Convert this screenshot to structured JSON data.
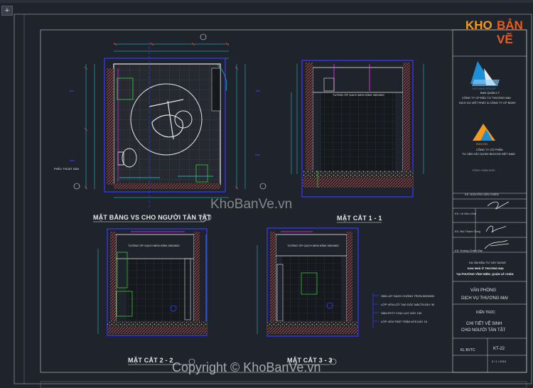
{
  "toolbar": {
    "new_tab_label": "+"
  },
  "titles": {
    "plan": "MẶT BẰNG VS CHO NGƯỜI TÀN TẬT",
    "sec11": "MẶT CẮT 1 - 1",
    "sec22": "MẶT CẮT 2 - 2",
    "sec33": "MẶT CẮT 3 - 3"
  },
  "section_notes": {
    "wall_tile_11": "TƯỜNG ỐP GẠCH MEN KÍNH 300X600",
    "wall_tile_22": "TƯỜNG ỐP GẠCH MEN KÍNH 300X600",
    "wall_tile_33": "TƯỜNG ỐP GẠCH MEN KÍNH 300X600",
    "floor_drain": "PHỄU THOÁT SÀN"
  },
  "legend": [
    "SÀN LÁT GẠCH CHỐNG TRƠN 600X600",
    "LỚP VỮA LÓT TẠO DỐC MÁC75 DÀY 30",
    "SÀN BTCT CHỊU LỰC DÀY 100",
    "LỚP VỮA TRÁT TRẦN M75 DÀY 15"
  ],
  "title_block": {
    "brand_part1": "KHO",
    "brand_part2": "BẢN VẼ",
    "company1_logo": "VIETNAM GROUP",
    "company1_role": "BAN QUẢN LÝ",
    "company1_line1": "CÔNG TY CP ĐẦU TƯ THƯƠNG MẠI",
    "company1_line2": "DỊCH VỤ VIỆT PHÁT & CÔNG TY CP BONY",
    "company2_logo": "BIGCON",
    "company2_line1": "CÔNG TY CỔ PHẦN",
    "company2_line2": "TƯ VẤN XÂY DỰNG BIGCON VIỆT NAM",
    "stamp_label": "TỔNG GIÁM ĐỐC",
    "director_label": "KS. NGUYỄN VĂN CHIẾN",
    "sig1_label": "KS. Lê Hữu Vinh",
    "sig2_label": "KS. Bùi Thanh Tùng",
    "sig3_label": "KS. Hoàng Chiến Bảo",
    "project_label": "DỰ ÁN ĐẦU TƯ XÂY DỰNG",
    "project_line1": "KHU NHÀ Ở THƯƠNG MẠI",
    "project_line2": "TẠI PHƯỜNG VĨNH NIỆM, QUẬN LÊ CHÂN",
    "building_line1": "VĂN PHÒNG",
    "building_line2": "DỊCH VỤ THƯƠNG MẠI",
    "category": "KIẾN TRÚC",
    "drawing_title1": "CHI TIẾT VỆ SINH",
    "drawing_title2": "CHO NGƯỜI TÀN TẬT",
    "phase": "KL BVTC",
    "drawing_no": "KT-22",
    "date": "0 / 1 / 2019"
  },
  "watermarks": {
    "center": "KhoBanVe.vn",
    "bottom": "Copyright © KhoBanVe.vn"
  },
  "colors": {
    "background": "#1f232b",
    "wall_blue": "#3b3bff",
    "cyan": "#22d6e8",
    "magenta": "#ff33ff",
    "white": "#e8e8e8",
    "red_hatch": "#d94040",
    "green": "#39c43e",
    "brand_orange": "#f49b1e"
  }
}
